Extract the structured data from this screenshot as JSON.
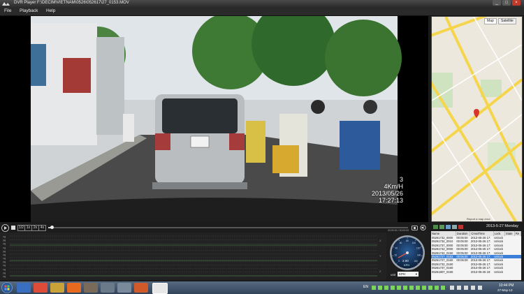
{
  "window": {
    "title": "DVR Player  F:\\DECIM\\VIETNAM\\0526\\052617\\27_0153.MOV",
    "controls": [
      "_",
      "□",
      "×"
    ]
  },
  "menu": [
    "File",
    "Playback",
    "Help"
  ],
  "video": {
    "overlay": {
      "value": "3",
      "speed": "4Km/H",
      "date": "2013/05/26",
      "time": "17:27:13"
    },
    "plate": "63H\n3333"
  },
  "map": {
    "map_button": "Map",
    "satellite_button": "Satellite",
    "credit": "Report a map error"
  },
  "controls": {
    "speeds": [
      "1/2",
      "1x",
      "2x",
      "4x"
    ],
    "progress_fraction": 0.01,
    "time": "00:00:00 / 00:00:00"
  },
  "graph": {
    "left_labels": [
      "xg",
      "yg",
      "zg",
      "xg",
      "yg",
      "zg",
      "xg",
      "yg",
      "zg",
      "xg",
      "yg",
      "zg"
    ],
    "right_labels": [
      "X",
      "Y",
      "Z"
    ]
  },
  "gauge": {
    "value": "2.00",
    "unit_label": "KPH",
    "unit_select_label": "unit",
    "unit_selected": "KPH",
    "tick_labels": [
      "0",
      "20",
      "40",
      "60",
      "80",
      "100",
      "120",
      "140",
      "160"
    ]
  },
  "panel": {
    "date": "2013-5-27 Monday"
  },
  "file_list": {
    "columns": [
      "Name",
      "Duration",
      "CreatTime",
      "Lock",
      "State",
      "Re"
    ],
    "rows": [
      {
        "name": "05261732_0000",
        "duration": "00:05:00",
        "created": "2013-05-26 17:",
        "lock": "Unlock",
        "state": ""
      },
      {
        "name": "05261732_0010",
        "duration": "00:05:00",
        "created": "2013-05-26 17:",
        "lock": "Unlock",
        "state": ""
      },
      {
        "name": "05261737_0000",
        "duration": "00:05:00",
        "created": "2013-05-26 17:",
        "lock": "Unlock",
        "state": ""
      },
      {
        "name": "05261742_0000",
        "duration": "00:05:00",
        "created": "2013-05-26 17:",
        "lock": "Unlock",
        "state": ""
      },
      {
        "name": "05261742_0150",
        "duration": "00:05:00",
        "created": "2013-05-26 17:",
        "lock": "Unlock",
        "state": ""
      },
      {
        "name": "05261727_0153",
        "duration": "00:05:00",
        "created": "2013-05-26 17:",
        "lock": "Unlock",
        "state": ""
      },
      {
        "name": "05261727_0160",
        "duration": "00:05:00",
        "created": "2013-05-26 17:",
        "lock": "Unlock",
        "state": ""
      },
      {
        "name": "05261732_0160",
        "duration": "",
        "created": "2013-05-26 17:",
        "lock": "Unlock",
        "state": ""
      },
      {
        "name": "05261737_0160",
        "duration": "",
        "created": "2013-05-26 17:",
        "lock": "Unlock",
        "state": ""
      },
      {
        "name": "05261807_0160",
        "duration": "",
        "created": "2013-05-26 18:",
        "lock": "Unlock",
        "state": ""
      }
    ],
    "selected_index": 5
  },
  "taskbar": {
    "language": "EN",
    "time": "10:44 PM",
    "date": "27-May-13"
  },
  "colors": {
    "accent": "#3c7fd8",
    "graph_line": "#5a9a5a",
    "map_road": "#f5d54c"
  }
}
